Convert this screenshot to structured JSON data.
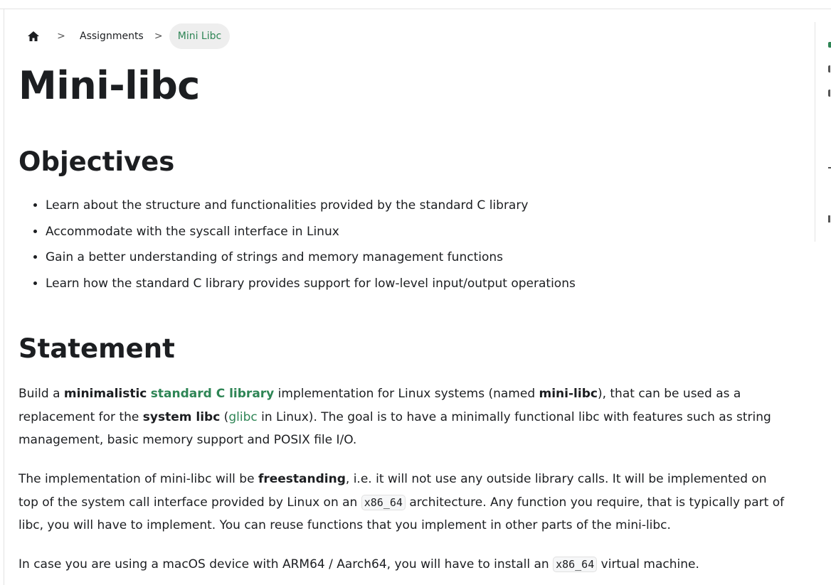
{
  "breadcrumb": {
    "home_icon": "home-icon",
    "separator": ">",
    "items": [
      "Assignments",
      "Mini Libc"
    ]
  },
  "page": {
    "title": "Mini-libc"
  },
  "objectives": {
    "heading": "Objectives",
    "items": [
      "Learn about the structure and functionalities provided by the standard C library",
      "Accommodate with the syscall interface in Linux",
      "Gain a better understanding of strings and memory management functions",
      "Learn how the standard C library provides support for low-level input/output operations"
    ]
  },
  "statement": {
    "heading": "Statement",
    "p1": {
      "t1": "Build a ",
      "b1": "minimalistic",
      "t2": " ",
      "link1": "standard C library",
      "t3": " implementation for Linux systems (named ",
      "b2": "mini-libc",
      "t4": "), that can be used as a replacement for the ",
      "b3": "system libc",
      "t5": " (",
      "link2": "glibc",
      "t6": " in Linux). The goal is to have a minimally functional libc with features such as string management, basic memory support and POSIX file I/O."
    },
    "p2": {
      "t1": "The implementation of mini-libc will be ",
      "b1": "freestanding",
      "t2": ", i.e. it will not use any outside library calls. It will be implemented on top of the system call interface provided by Linux on an ",
      "code1": "x86_64",
      "t3": " architecture. Any function you require, that is typically part of libc, you will have to implement. You can reuse functions that you implement in other parts of the mini-libc."
    },
    "p3": {
      "t1": "In case you are using a macOS device with ARM64 / Aarch64, you will have to install an ",
      "code1": "x86_64",
      "t2": " virtual machine."
    }
  },
  "colors": {
    "link": "#2e8555",
    "text": "#1c1e21",
    "active_crumb_bg": "#eeeeee"
  }
}
